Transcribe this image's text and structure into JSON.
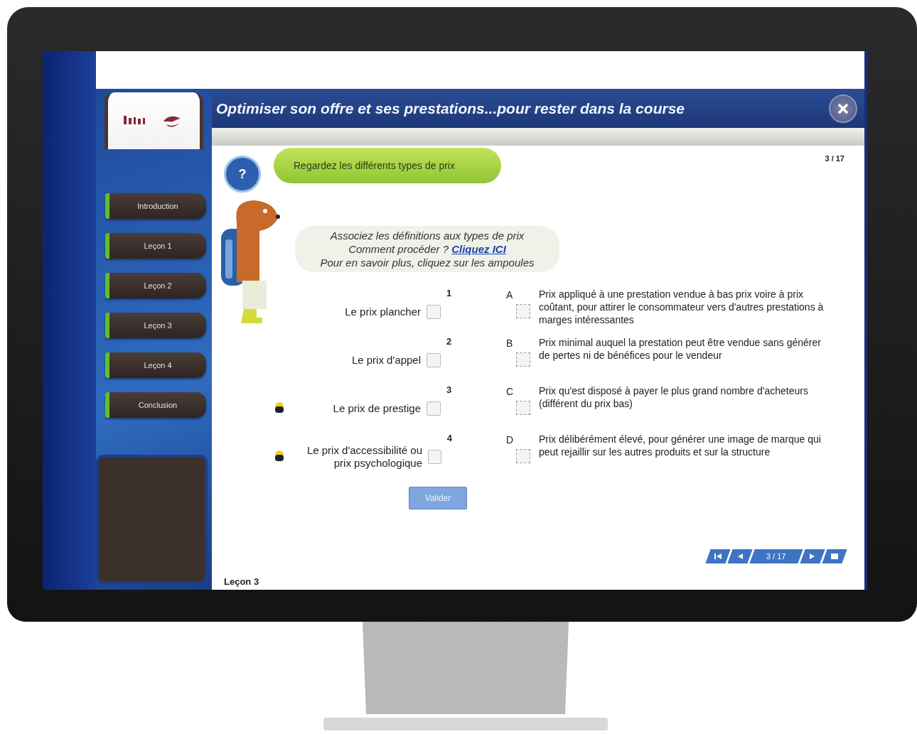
{
  "header": {
    "title": "Optimiser son offre et ses prestations...pour rester dans la course"
  },
  "menu": [
    {
      "label": "Introduction"
    },
    {
      "label": "Leçon 1"
    },
    {
      "label": "Leçon 2"
    },
    {
      "label": "Leçon 3"
    },
    {
      "label": "Leçon 4"
    },
    {
      "label": "Conclusion"
    }
  ],
  "help_button": "?",
  "speech_bubble": "Regardez les différents types de prix",
  "page_counter": "3 / 17",
  "instructions": {
    "line_1": "Associez les définitions aux types de prix",
    "line_2": "Comment procéder ?",
    "link": "Cliquez ICI",
    "line_3": "Pour en savoir plus, cliquez sur les ampoules"
  },
  "terms": [
    {
      "label": "Le prix plancher",
      "number": "1",
      "bulb": false
    },
    {
      "label": "Le prix d'appel",
      "number": "2",
      "bulb": false
    },
    {
      "label": "Le prix de prestige",
      "number": "3",
      "bulb": true
    },
    {
      "label": "Le prix d'accessibilité ou prix psychologique",
      "number": "4",
      "bulb": true
    }
  ],
  "definitions": [
    {
      "letter": "A",
      "text": "Prix appliqué à une prestation vendue à bas prix voire à prix coûtant, pour attirer le consommateur vers d'autres prestations à marges intéressantes"
    },
    {
      "letter": "B",
      "text": "Prix minimal auquel la prestation peut être vendue sans générer de pertes ni de bénéfices pour le vendeur"
    },
    {
      "letter": "C",
      "text": "Prix qu'est disposé à payer le plus grand nombre d'acheteurs (différent du prix bas)"
    },
    {
      "letter": "D",
      "text": "Prix délibérément élevé, pour générer une image de marque qui peut rejaillir sur les autres produits et sur la structure"
    }
  ],
  "validate_button": "Valider",
  "pager": {
    "counter": "3 / 17"
  },
  "lesson_label": "Leçon 3"
}
